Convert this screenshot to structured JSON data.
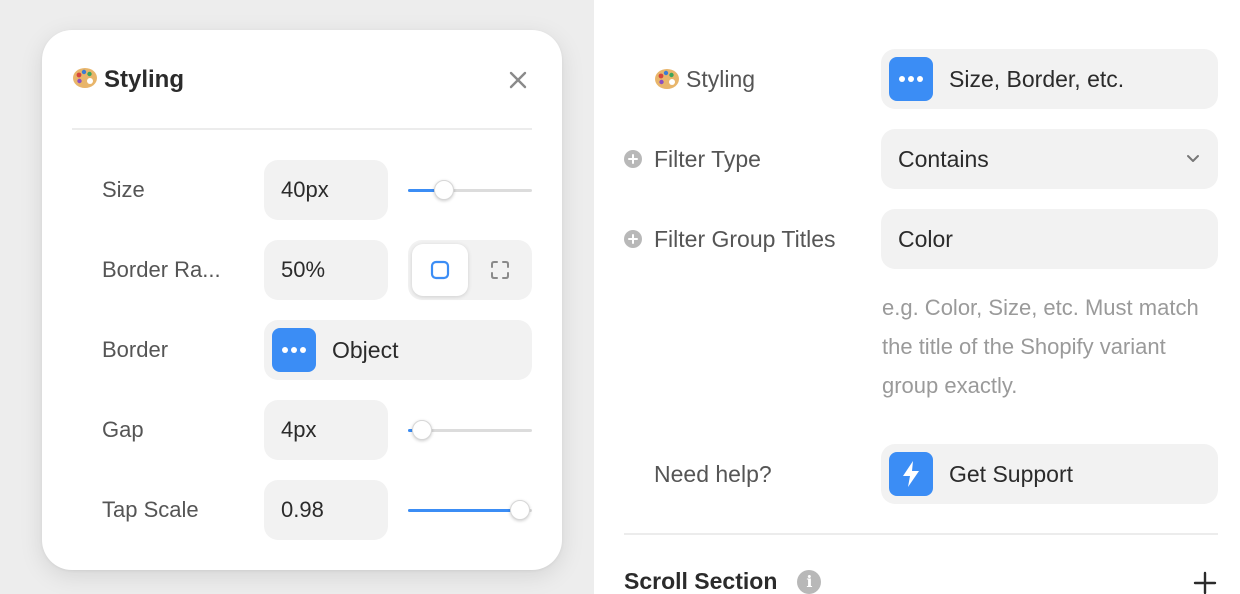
{
  "popover": {
    "title_icon": "palette-icon",
    "title": "Styling",
    "close_icon": "close-icon",
    "rows": {
      "size": {
        "label": "Size",
        "value": "40px",
        "slider_fraction": 0.29
      },
      "border_radius": {
        "label": "Border Ra...",
        "value": "50%",
        "modes": [
          "rounded-square-icon",
          "corners-icon"
        ],
        "selected_mode": "rounded-square-icon"
      },
      "border": {
        "label": "Border",
        "value": "Object",
        "icon": "more-dots-icon"
      },
      "gap": {
        "label": "Gap",
        "value": "4px",
        "slider_fraction": 0.11
      },
      "tap_scale": {
        "label": "Tap Scale",
        "value": "0.98",
        "slider_fraction": 0.9
      }
    }
  },
  "panel": {
    "styling": {
      "label": "Styling",
      "icon": "palette-icon",
      "value": "Size, Border, etc.",
      "value_icon": "more-dots-icon"
    },
    "filter_type": {
      "label": "Filter Type",
      "value": "Contains"
    },
    "filter_group_titles": {
      "label": "Filter Group Titles",
      "value": "Color",
      "help": "e.g. Color, Size, etc. Must match the title of the Shopify variant group exactly."
    },
    "need_help": {
      "label": "Need help?",
      "button": "Get Support",
      "icon": "lightning-icon"
    },
    "scroll_section": {
      "title": "Scroll Section",
      "info_glyph": "i"
    }
  },
  "colors": {
    "accent": "#3b8df5",
    "field_bg": "#f2f2f2",
    "backdrop": "#ededed"
  }
}
